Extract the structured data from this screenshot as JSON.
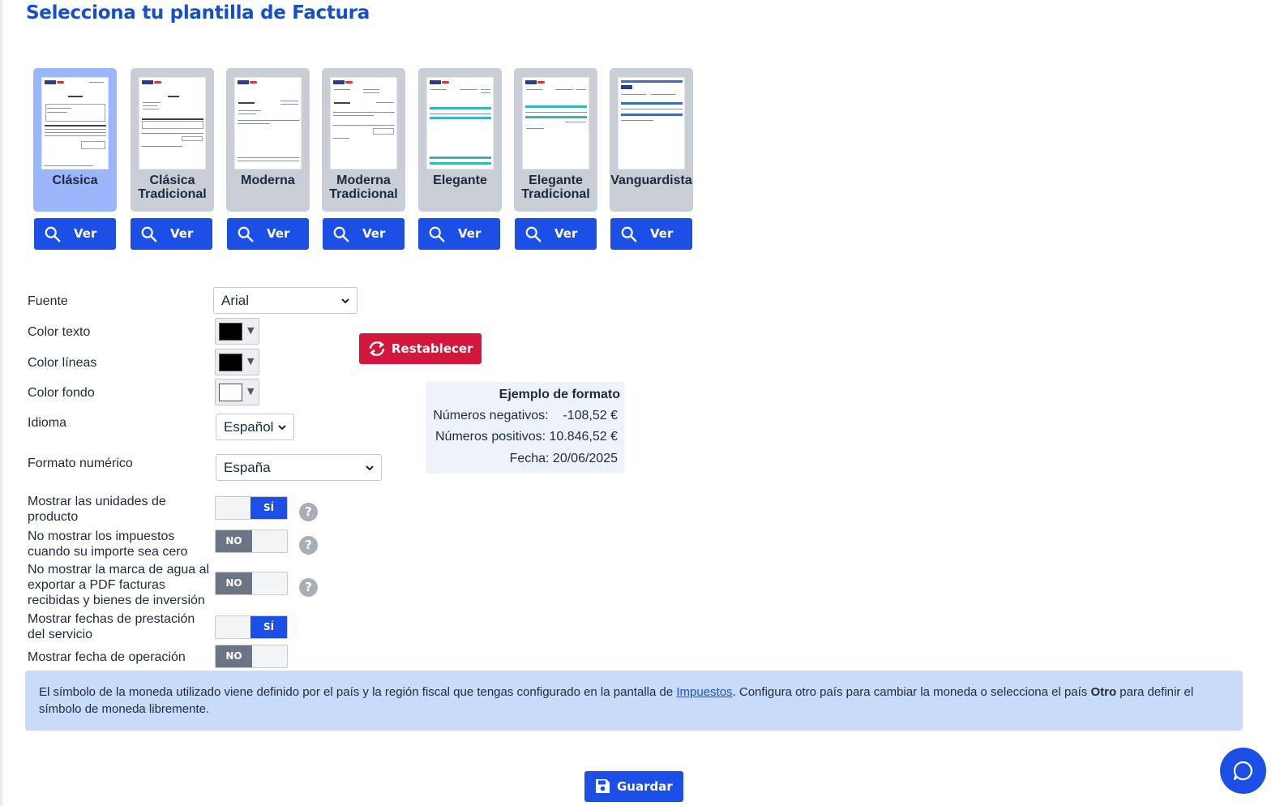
{
  "page": {
    "title": "Selecciona tu plantilla de Factura"
  },
  "templates": [
    {
      "name": "Clásica",
      "selected": true,
      "button": "Ver"
    },
    {
      "name": "Clásica Tradicional",
      "selected": false,
      "button": "Ver"
    },
    {
      "name": "Moderna",
      "selected": false,
      "button": "Ver"
    },
    {
      "name": "Moderna Tradicional",
      "selected": false,
      "button": "Ver"
    },
    {
      "name": "Elegante",
      "selected": false,
      "button": "Ver"
    },
    {
      "name": "Elegante Tradicional",
      "selected": false,
      "button": "Ver"
    },
    {
      "name": "Vanguardista",
      "selected": false,
      "button": "Ver"
    }
  ],
  "form": {
    "font_label": "Fuente",
    "font_value": "Arial",
    "text_color_label": "Color texto",
    "text_color_value": "#000000",
    "line_color_label": "Color líneas",
    "line_color_value": "#000000",
    "bg_color_label": "Color fondo",
    "bg_color_value": "#ffffff",
    "language_label": "Idioma",
    "language_value": "Español",
    "number_format_label": "Formato numérico",
    "number_format_value": "España",
    "reset_label": "Restablecer"
  },
  "format_example": {
    "title": "Ejemplo de formato",
    "negative": "Números negativos:    -108,52 €",
    "positive": "Números positivos: 10.846,52 €",
    "date": "Fecha: 20/06/2025"
  },
  "toggles": [
    {
      "label": "Mostrar las unidades de producto",
      "state": "SÍ",
      "on": true,
      "help": true
    },
    {
      "label": "No mostrar los impuestos cuando su importe sea cero",
      "state": "NO",
      "on": false,
      "help": true
    },
    {
      "label": "No mostrar la marca de agua al exportar a PDF facturas recibidas y bienes de inversión",
      "state": "NO",
      "on": false,
      "help": true
    },
    {
      "label": "Mostrar fechas de prestación del servicio",
      "state": "SÍ",
      "on": true,
      "help": false
    },
    {
      "label": "Mostrar fecha de operación",
      "state": "NO",
      "on": false,
      "help": false
    }
  ],
  "info": {
    "text_before": "El símbolo de la moneda utilizado viene definido por el país y la región fiscal que tengas configurado en la pantalla de ",
    "link": "Impuestos",
    "text_middle": ". Configura otro país para cambiar la moneda o selecciona el país ",
    "bold": "Otro",
    "text_after": " para definir el símbolo de moneda libremente."
  },
  "save_label": "Guardar",
  "colors": {
    "primary": "#1b4fe6",
    "danger": "#d2163c",
    "selected_card": "#9cb6fb",
    "info_bg": "#c9dbfb"
  },
  "icons": {
    "view": "search-icon",
    "reset": "refresh-icon",
    "save": "floppy-disk-icon",
    "chat": "chat-bubble-icon",
    "help": "question-icon"
  }
}
